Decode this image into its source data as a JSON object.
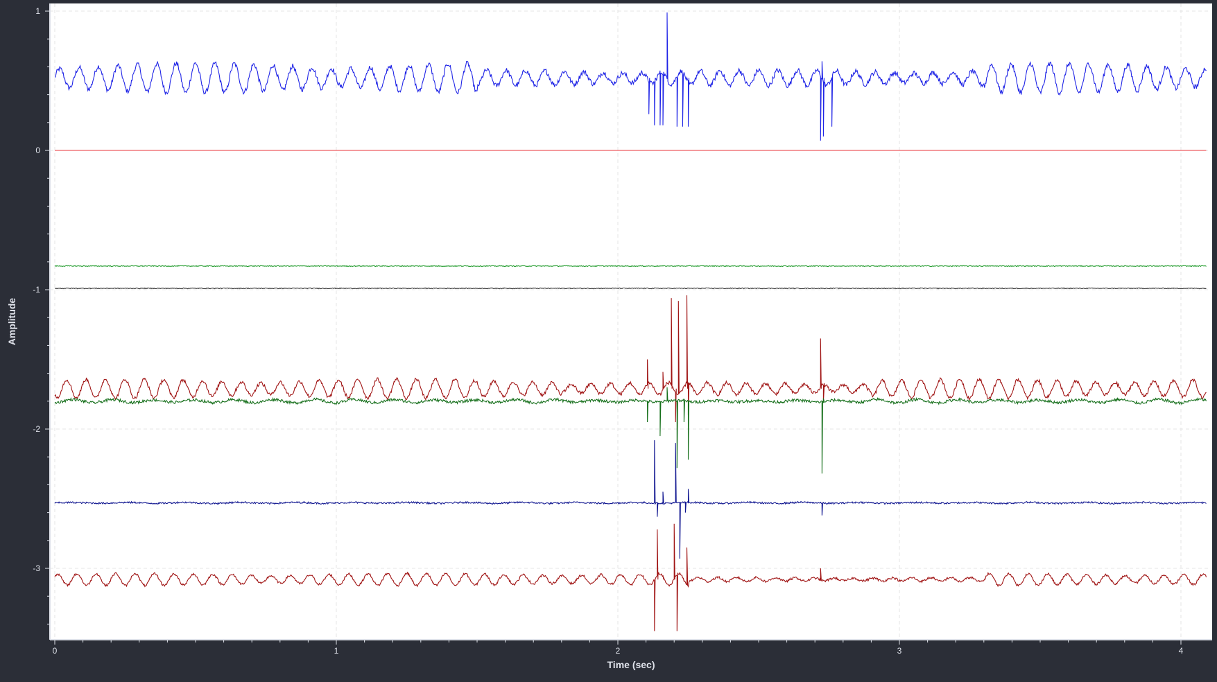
{
  "chart_data": {
    "type": "line",
    "title": "",
    "xlabel": "Time (sec)",
    "ylabel": "Amplitude",
    "xlim": [
      0,
      4.1
    ],
    "ylim": [
      -3.45,
      1.02
    ],
    "xticks": [
      0,
      1,
      2,
      3,
      4
    ],
    "yticks": [
      1,
      0,
      -1,
      -2,
      -3
    ],
    "grid": true,
    "legend": "none",
    "series": [
      {
        "color": "#1f24e6",
        "base": 0.52,
        "noise": 0.018,
        "wave": {
          "amp": 0.085,
          "freq": 14.5,
          "ampLate": 0.045,
          "quietFrom": 1.5,
          "quietTo": 3.3
        },
        "events": [
          {
            "t": 2.11,
            "v": 0.26
          },
          {
            "t": 2.13,
            "v": 0.18
          },
          {
            "t": 2.15,
            "v": 0.18
          },
          {
            "t": 2.16,
            "v": 0.18
          },
          {
            "t": 2.175,
            "v": 0.99
          },
          {
            "t": 2.21,
            "v": 0.17
          },
          {
            "t": 2.23,
            "v": 0.17
          },
          {
            "t": 2.25,
            "v": 0.17
          },
          {
            "t": 2.72,
            "v": 0.07
          },
          {
            "t": 2.725,
            "v": 0.64
          },
          {
            "t": 2.73,
            "v": 0.1
          },
          {
            "t": 2.76,
            "v": 0.17
          }
        ]
      },
      {
        "color": "#e8343a",
        "base": 0.0,
        "noise": 0.0,
        "wave": {
          "amp": 0.0,
          "freq": 1,
          "ampLate": 0.0,
          "quietFrom": 0,
          "quietTo": 0
        },
        "events": []
      },
      {
        "color": "#1f9a2a",
        "base": -0.83,
        "noise": 0.003,
        "wave": {
          "amp": 0.0,
          "freq": 1,
          "ampLate": 0.0,
          "quietFrom": 0,
          "quietTo": 0
        },
        "events": []
      },
      {
        "color": "#3a3a3a",
        "base": -0.99,
        "noise": 0.003,
        "wave": {
          "amp": 0.0,
          "freq": 1,
          "ampLate": 0.0,
          "quietFrom": 0,
          "quietTo": 0
        },
        "events": []
      },
      {
        "color": "#a01414",
        "base": -1.71,
        "noise": 0.012,
        "wave": {
          "amp": 0.055,
          "freq": 14.5,
          "ampLate": 0.035,
          "quietFrom": 1.8,
          "quietTo": 2.9
        },
        "events": [
          {
            "t": 2.105,
            "v": -1.5
          },
          {
            "t": 2.16,
            "v": -1.59
          },
          {
            "t": 2.19,
            "v": -1.06
          },
          {
            "t": 2.205,
            "v": -1.95
          },
          {
            "t": 2.215,
            "v": -1.08
          },
          {
            "t": 2.245,
            "v": -1.04
          },
          {
            "t": 2.25,
            "v": -1.9
          },
          {
            "t": 2.72,
            "v": -1.35
          },
          {
            "t": 2.73,
            "v": -1.8
          }
        ]
      },
      {
        "color": "#17701c",
        "base": -1.8,
        "noise": 0.01,
        "wave": {
          "amp": 0.01,
          "freq": 7,
          "ampLate": 0.006,
          "quietFrom": 1.8,
          "quietTo": 2.9
        },
        "events": [
          {
            "t": 2.105,
            "v": -1.95
          },
          {
            "t": 2.15,
            "v": -2.05
          },
          {
            "t": 2.175,
            "v": -1.7
          },
          {
            "t": 2.21,
            "v": -2.28
          },
          {
            "t": 2.235,
            "v": -1.95
          },
          {
            "t": 2.25,
            "v": -2.22
          },
          {
            "t": 2.725,
            "v": -2.32
          },
          {
            "t": 2.73,
            "v": -1.78
          }
        ]
      },
      {
        "color": "#101690",
        "base": -2.53,
        "noise": 0.006,
        "wave": {
          "amp": 0.003,
          "freq": 5,
          "ampLate": 0.003,
          "quietFrom": 0,
          "quietTo": 0
        },
        "events": [
          {
            "t": 2.13,
            "v": -2.08
          },
          {
            "t": 2.14,
            "v": -2.63
          },
          {
            "t": 2.16,
            "v": -2.45
          },
          {
            "t": 2.205,
            "v": -2.1
          },
          {
            "t": 2.22,
            "v": -2.93
          },
          {
            "t": 2.24,
            "v": -2.6
          },
          {
            "t": 2.25,
            "v": -2.43
          },
          {
            "t": 2.725,
            "v": -2.62
          }
        ]
      },
      {
        "color": "#a01414",
        "base": -3.08,
        "noise": 0.008,
        "wave": {
          "amp": 0.035,
          "freq": 14.5,
          "ampLate": 0.012,
          "quietFrom": 2.25,
          "quietTo": 3.3
        },
        "events": [
          {
            "t": 2.13,
            "v": -3.45
          },
          {
            "t": 2.14,
            "v": -2.72
          },
          {
            "t": 2.16,
            "v": -3.05
          },
          {
            "t": 2.2,
            "v": -2.68
          },
          {
            "t": 2.21,
            "v": -3.45
          },
          {
            "t": 2.245,
            "v": -2.85
          },
          {
            "t": 2.72,
            "v": -3.0
          }
        ]
      }
    ]
  }
}
